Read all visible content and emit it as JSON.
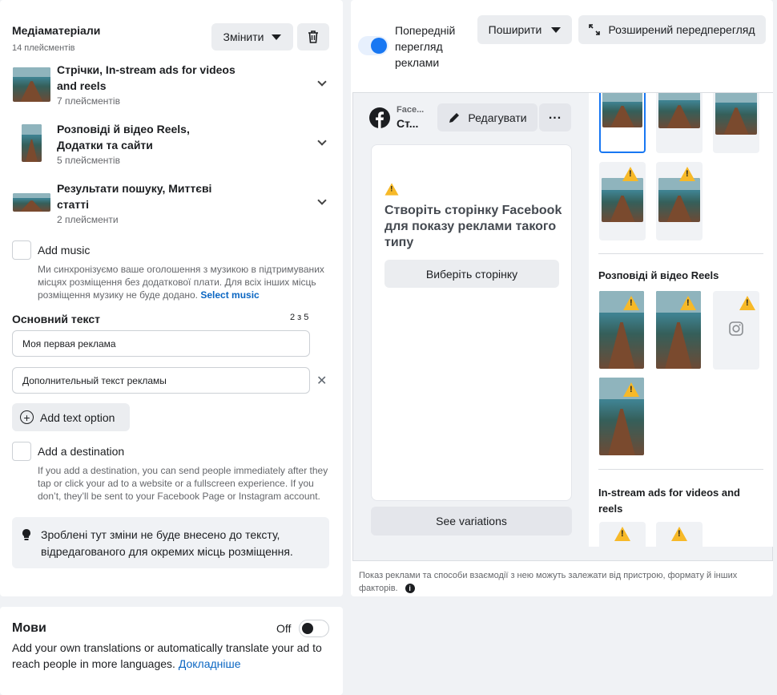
{
  "media": {
    "title": "Медіаматеріали",
    "subtitle": "14 плейсментів",
    "change_label": "Змінити",
    "groups": [
      {
        "title_line1": "Стрічки, In-stream ads for videos",
        "title_line2": "and reels",
        "count": "7 плейсментів"
      },
      {
        "title_line1": "Розповіді й відео Reels,",
        "title_line2": "Додатки та сайти",
        "count": "5 плейсментів"
      },
      {
        "title_line1": "Результати пошуку, Миттєві",
        "title_line2": "статті",
        "count": "2 плейсменти"
      }
    ]
  },
  "music": {
    "label": "Add music",
    "desc_line1": "Ми синхронізуємо ваше оголошення з музикою в підтримуваних",
    "desc_line2": "місцях розміщення без додаткової плати. Для всіх інших місць",
    "desc_line3": "розміщення музику не буде додано.",
    "link": "Select music"
  },
  "primary_text": {
    "label": "Основний текст",
    "counter": "2 з 5",
    "value1": "Моя первая реклама",
    "value2": "Дополнительный текст рекламы",
    "add_option": "Add text option"
  },
  "destination": {
    "label": "Add a destination",
    "desc_line1": "If you add a destination, you can send people immediately after they",
    "desc_line2": "tap or click your ad to a website or a fullscreen experience. If you",
    "desc_line3": "don’t, they’ll be sent to your Facebook Page or Instagram account."
  },
  "info": {
    "line1": "Зроблені тут зміни не буде внесено до тексту,",
    "line2": "відредагованого для окремих місць розміщення."
  },
  "languages": {
    "title": "Мови",
    "toggle_label": "Off",
    "desc_line1": "Add your own translations or automatically translate your ad to",
    "desc_line2": "reach people in more languages.",
    "link": "Докладніше"
  },
  "preview": {
    "toggle_line1": "Попередній",
    "toggle_line2": "перегляд",
    "toggle_line3": "реклами",
    "share_label": "Поширити",
    "advanced_label": "Розширений передперегляд",
    "page_name_top": "Face...",
    "page_name_bottom": "Ст...",
    "edit_label": "Редагувати",
    "warning_line1": "Створіть сторінку Facebook",
    "warning_line2": "для показу реклами такого",
    "warning_line3": "типу",
    "choose_page": "Виберіть сторінку",
    "see_variations": "See variations",
    "section_stories": "Розповіді й відео Reels",
    "section_instream_line1": "In-stream ads for videos and",
    "section_instream_line2": "reels",
    "footer_line1": "Показ реклами та способи взаємодії з нею можуть залежати від пристрою, формату й інших",
    "footer_line2": "факторів."
  },
  "colors": {
    "accent": "#1877f2",
    "link": "#0a66c2",
    "warning": "#f7b928"
  }
}
